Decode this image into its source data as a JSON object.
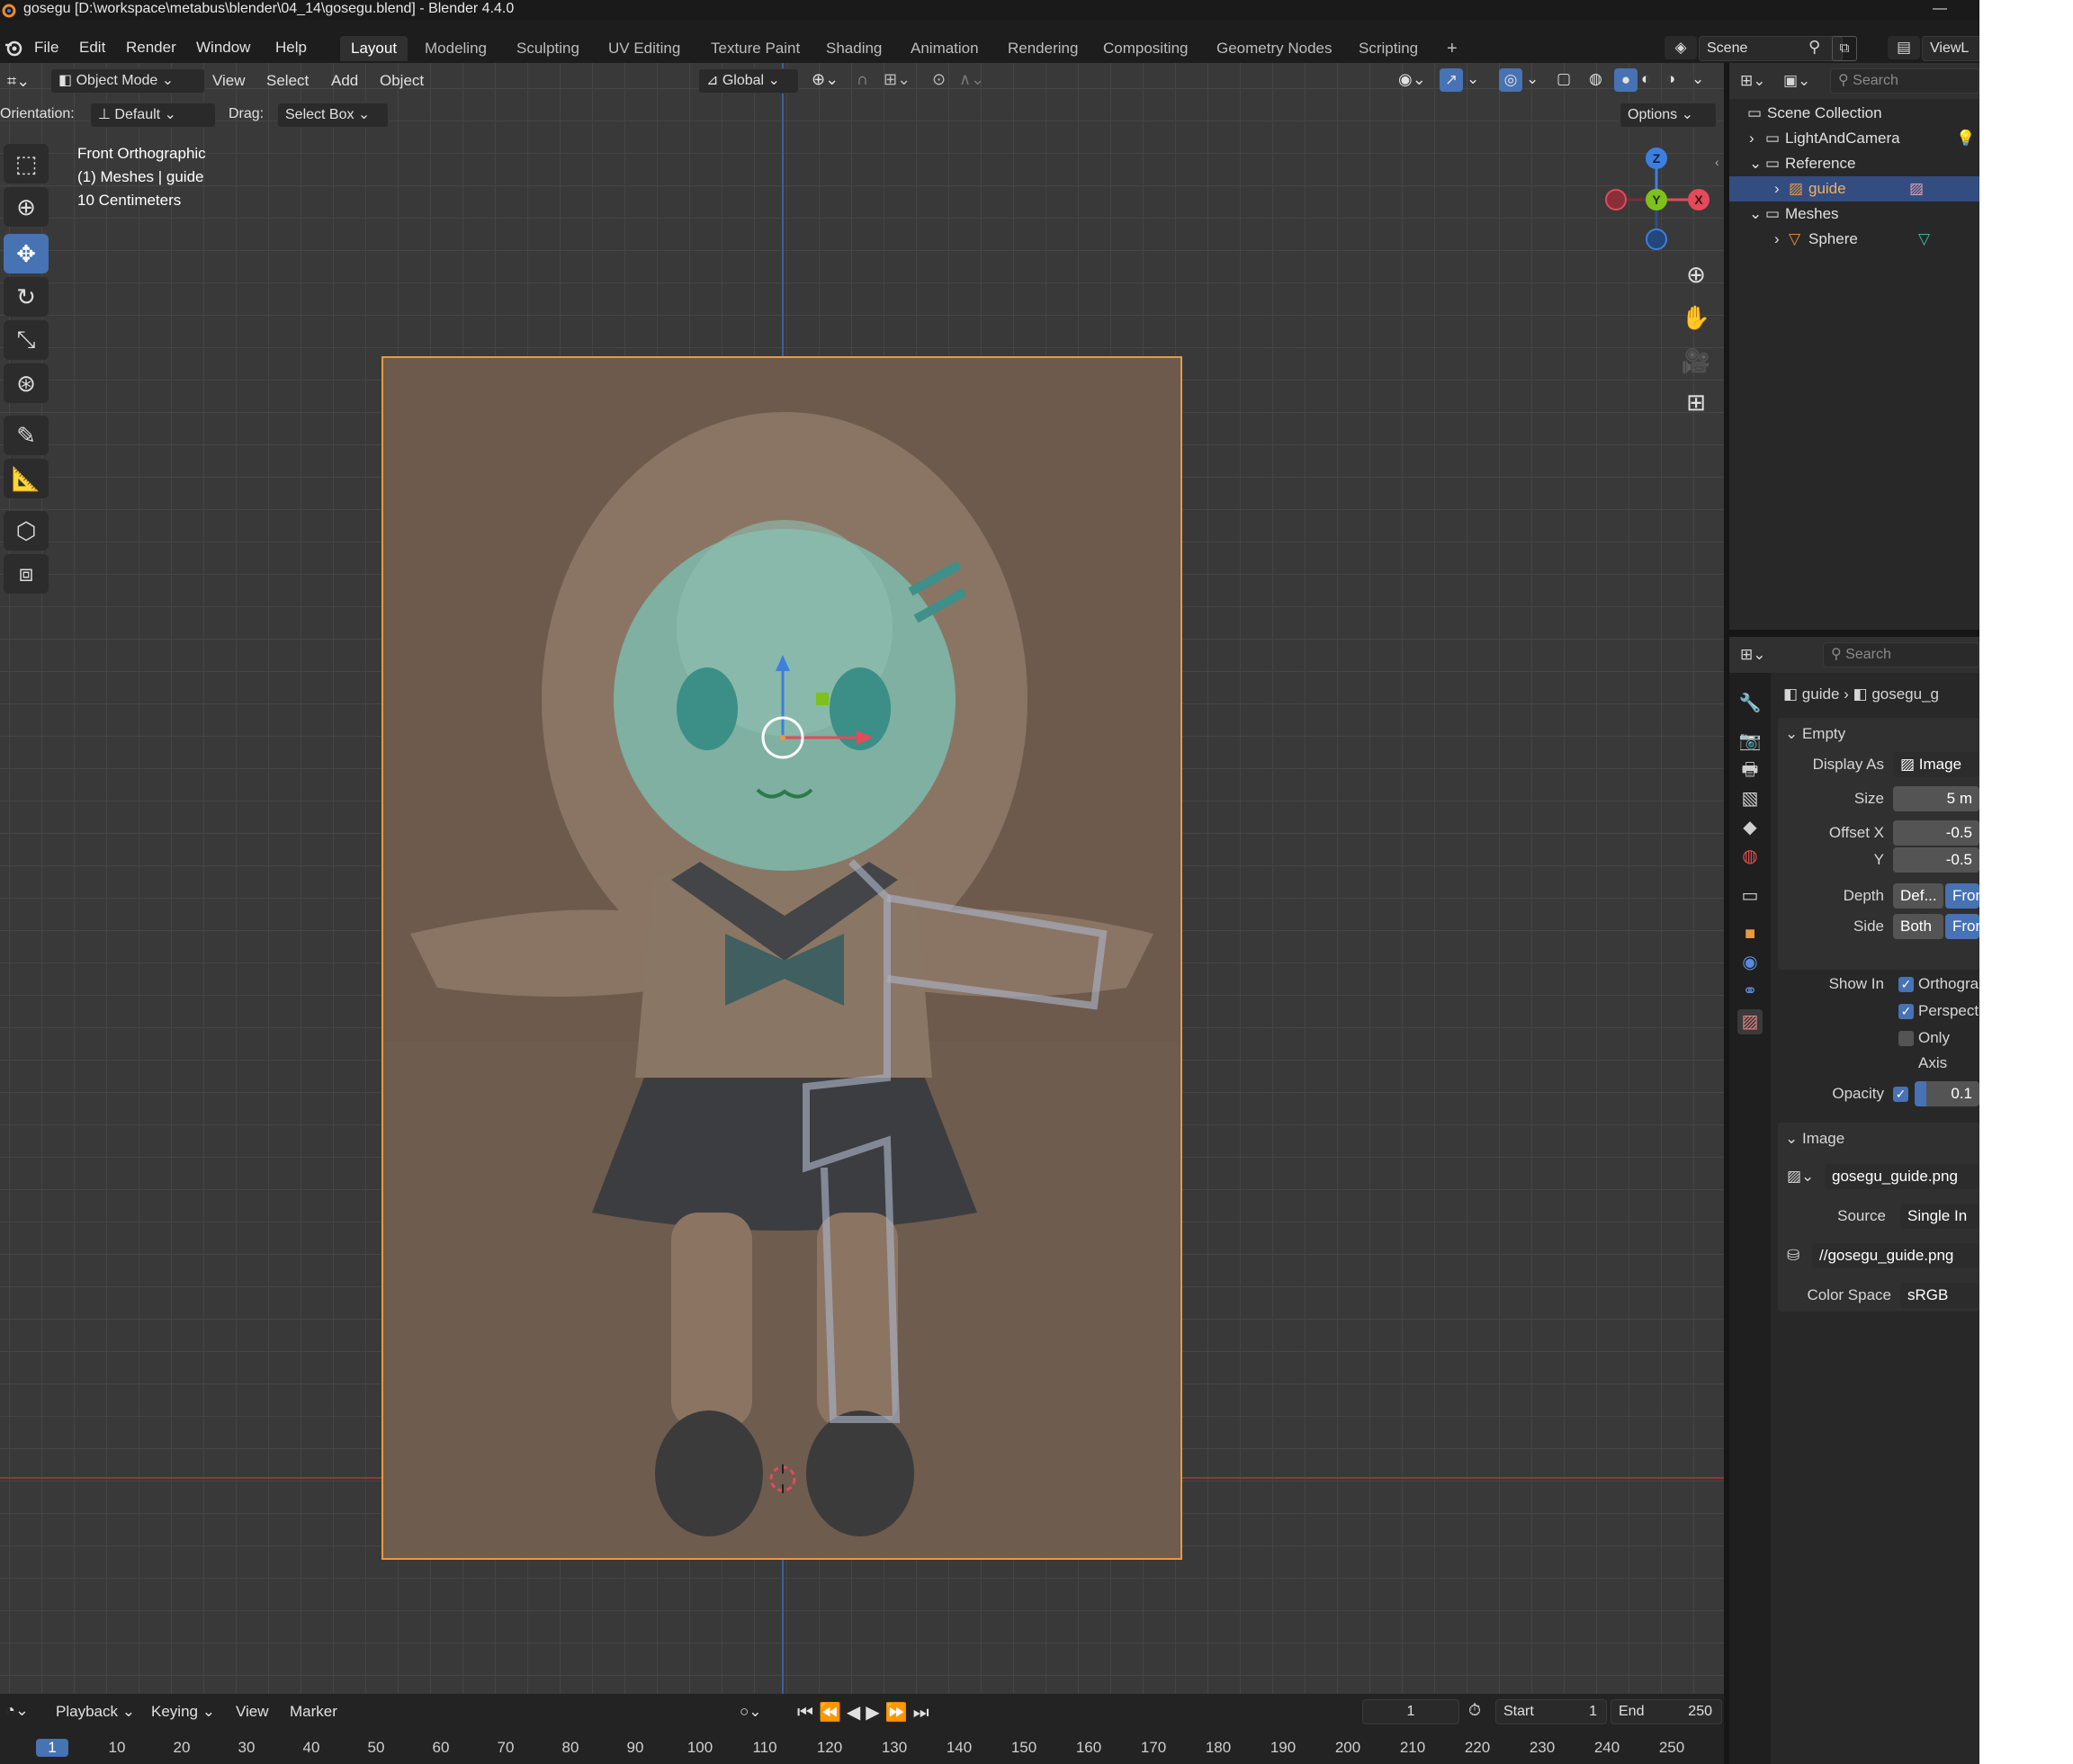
{
  "window": {
    "title": "gosegu [D:\\workspace\\metabus\\blender\\04_14\\gosegu.blend] - Blender 4.4.0",
    "minimize_glyph": "—"
  },
  "menu": [
    "File",
    "Edit",
    "Render",
    "Window",
    "Help"
  ],
  "workspaces": [
    "Layout",
    "Modeling",
    "Sculpting",
    "UV Editing",
    "Texture Paint",
    "Shading",
    "Animation",
    "Rendering",
    "Compositing",
    "Geometry Nodes",
    "Scripting"
  ],
  "active_workspace": "Layout",
  "add_workspace": "+",
  "scene": {
    "label": "Scene",
    "view_layer": "ViewL"
  },
  "viewport": {
    "mode": "Object Mode",
    "menus": [
      "View",
      "Select",
      "Add",
      "Object"
    ],
    "transform_orientation": "Global",
    "orientation_label": "Orientation:",
    "orientation_value": "Default",
    "drag_label": "Drag:",
    "drag_value": "Select Box",
    "options": "Options",
    "overlay_lines": [
      "Front Orthographic",
      "(1) Meshes | guide",
      "10 Centimeters"
    ],
    "gizmo": {
      "z": "Z",
      "y": "Y",
      "x": "X"
    }
  },
  "outliner": {
    "search_placeholder": "Search",
    "rows": [
      {
        "label": "Scene Collection",
        "level": 0
      },
      {
        "label": "LightAndCamera",
        "level": 1
      },
      {
        "label": "Reference",
        "level": 1
      },
      {
        "label": "guide",
        "level": 2,
        "selected": true
      },
      {
        "label": "Meshes",
        "level": 1
      },
      {
        "label": "Sphere",
        "level": 2
      }
    ]
  },
  "properties": {
    "search_placeholder": "Search",
    "breadcrumb": [
      "guide",
      "gosegu_g"
    ],
    "empty_panel": "Empty",
    "display_as_label": "Display As",
    "display_as_value": "Image",
    "size_label": "Size",
    "size_value": "5 m",
    "offset_x_label": "Offset X",
    "offset_x_value": "-0.5",
    "offset_y_label": "Y",
    "offset_y_value": "-0.5",
    "depth_label": "Depth",
    "depth_options": [
      "Def...",
      "Fron"
    ],
    "side_label": "Side",
    "side_options": [
      "Both",
      "Fron"
    ],
    "show_in_label": "Show In",
    "show_in": [
      {
        "label": "Orthogra",
        "checked": true
      },
      {
        "label": "Perspect",
        "checked": true
      },
      {
        "label": "Only Axis",
        "checked": false
      }
    ],
    "opacity_label": "Opacity",
    "opacity_value": "0.1",
    "image_panel": "Image",
    "image_name": "gosegu_guide.png",
    "source_label": "Source",
    "source_value": "Single In",
    "filepath": "//gosegu_guide.png",
    "color_space_label": "Color Space",
    "color_space_value": "sRGB"
  },
  "timeline": {
    "menus": [
      "Playback",
      "Keying",
      "View",
      "Marker"
    ],
    "current_frame": "1",
    "start_label": "Start",
    "start_value": "1",
    "end_label": "End",
    "end_value": "250",
    "ticks": [
      "1",
      "10",
      "20",
      "30",
      "40",
      "50",
      "60",
      "70",
      "80",
      "90",
      "100",
      "110",
      "120",
      "130",
      "140",
      "150",
      "160",
      "170",
      "180",
      "190",
      "200",
      "210",
      "220",
      "230",
      "240",
      "250"
    ]
  },
  "colors": {
    "accent": "#4772b3",
    "selection": "#334d80",
    "active_object": "#e89a3c",
    "x_axis": "#e34a5a",
    "y_axis": "#7ec11a",
    "z_axis": "#3d7fdf"
  }
}
